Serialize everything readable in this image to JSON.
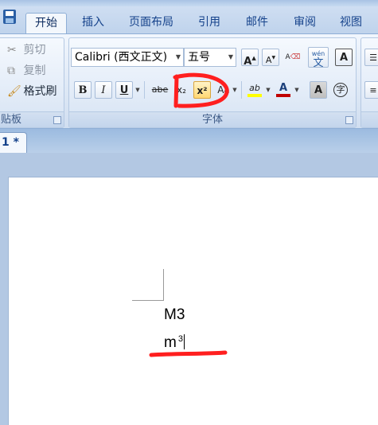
{
  "tabs": [
    {
      "label": "开始",
      "active": true
    },
    {
      "label": "插入"
    },
    {
      "label": "页面布局"
    },
    {
      "label": "引用"
    },
    {
      "label": "邮件"
    },
    {
      "label": "审阅"
    },
    {
      "label": "视图"
    }
  ],
  "clipboard": {
    "cut": "剪切",
    "copy": "复制",
    "format_painter": "格式刷",
    "group_label": "贴板"
  },
  "font": {
    "font_name": "Calibri (西文正文)",
    "font_size": "五号",
    "grow_label": "A",
    "shrink_label": "A",
    "phonetic_label": "wén",
    "phonetic_char": "文",
    "border_label": "A",
    "bold": "B",
    "italic": "I",
    "underline": "U",
    "strike": "abe",
    "subscript": "x₂",
    "superscript": "x²",
    "change_case": "Aa",
    "highlight": "ab",
    "font_color": "A",
    "shading": "A",
    "enclose": "字",
    "group_label": "字体"
  },
  "document": {
    "tab_label": "1 *",
    "line1": "M3",
    "line2_base": "m",
    "line2_sup": "3"
  },
  "colors": {
    "accent": "#15428b",
    "annotation": "#ff1f1f",
    "font_color_bar": "#c00000",
    "highlight_bar": "#ffff00"
  }
}
